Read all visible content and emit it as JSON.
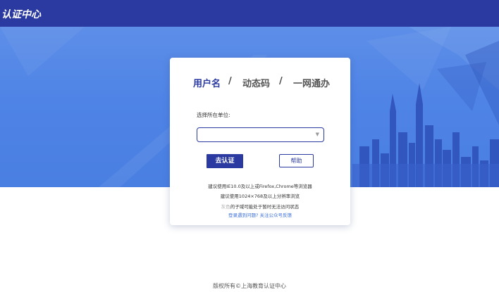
{
  "header": {
    "logo_text": "认证中心"
  },
  "login_card": {
    "tabs": [
      {
        "label": "用户名",
        "active": true
      },
      {
        "label": "动态码",
        "active": false
      },
      {
        "label": "一网通办",
        "active": false
      }
    ],
    "tab_separator": "/",
    "unit_label": "选择所在单位:",
    "unit_select_value": "",
    "submit_label": "去认证",
    "help_label": "帮助",
    "browser_tip": "建议使用IE10.0及以上或Firefox,Chrome等浏览器",
    "resolution_tip": "建议使用1024×768及以上分辨率浏览",
    "gray_note_prefix": "灰色",
    "gray_note_rest": "的子域可能处于暂时无法访问状态",
    "feedback_link": "登录遇到问题? 关注公众号反馈"
  },
  "footer": {
    "copyright": "版权所有©上海教育认证中心"
  },
  "colors": {
    "brand": "#2b3aa0",
    "banner": "#4f84e6",
    "link": "#3b6fd6"
  }
}
